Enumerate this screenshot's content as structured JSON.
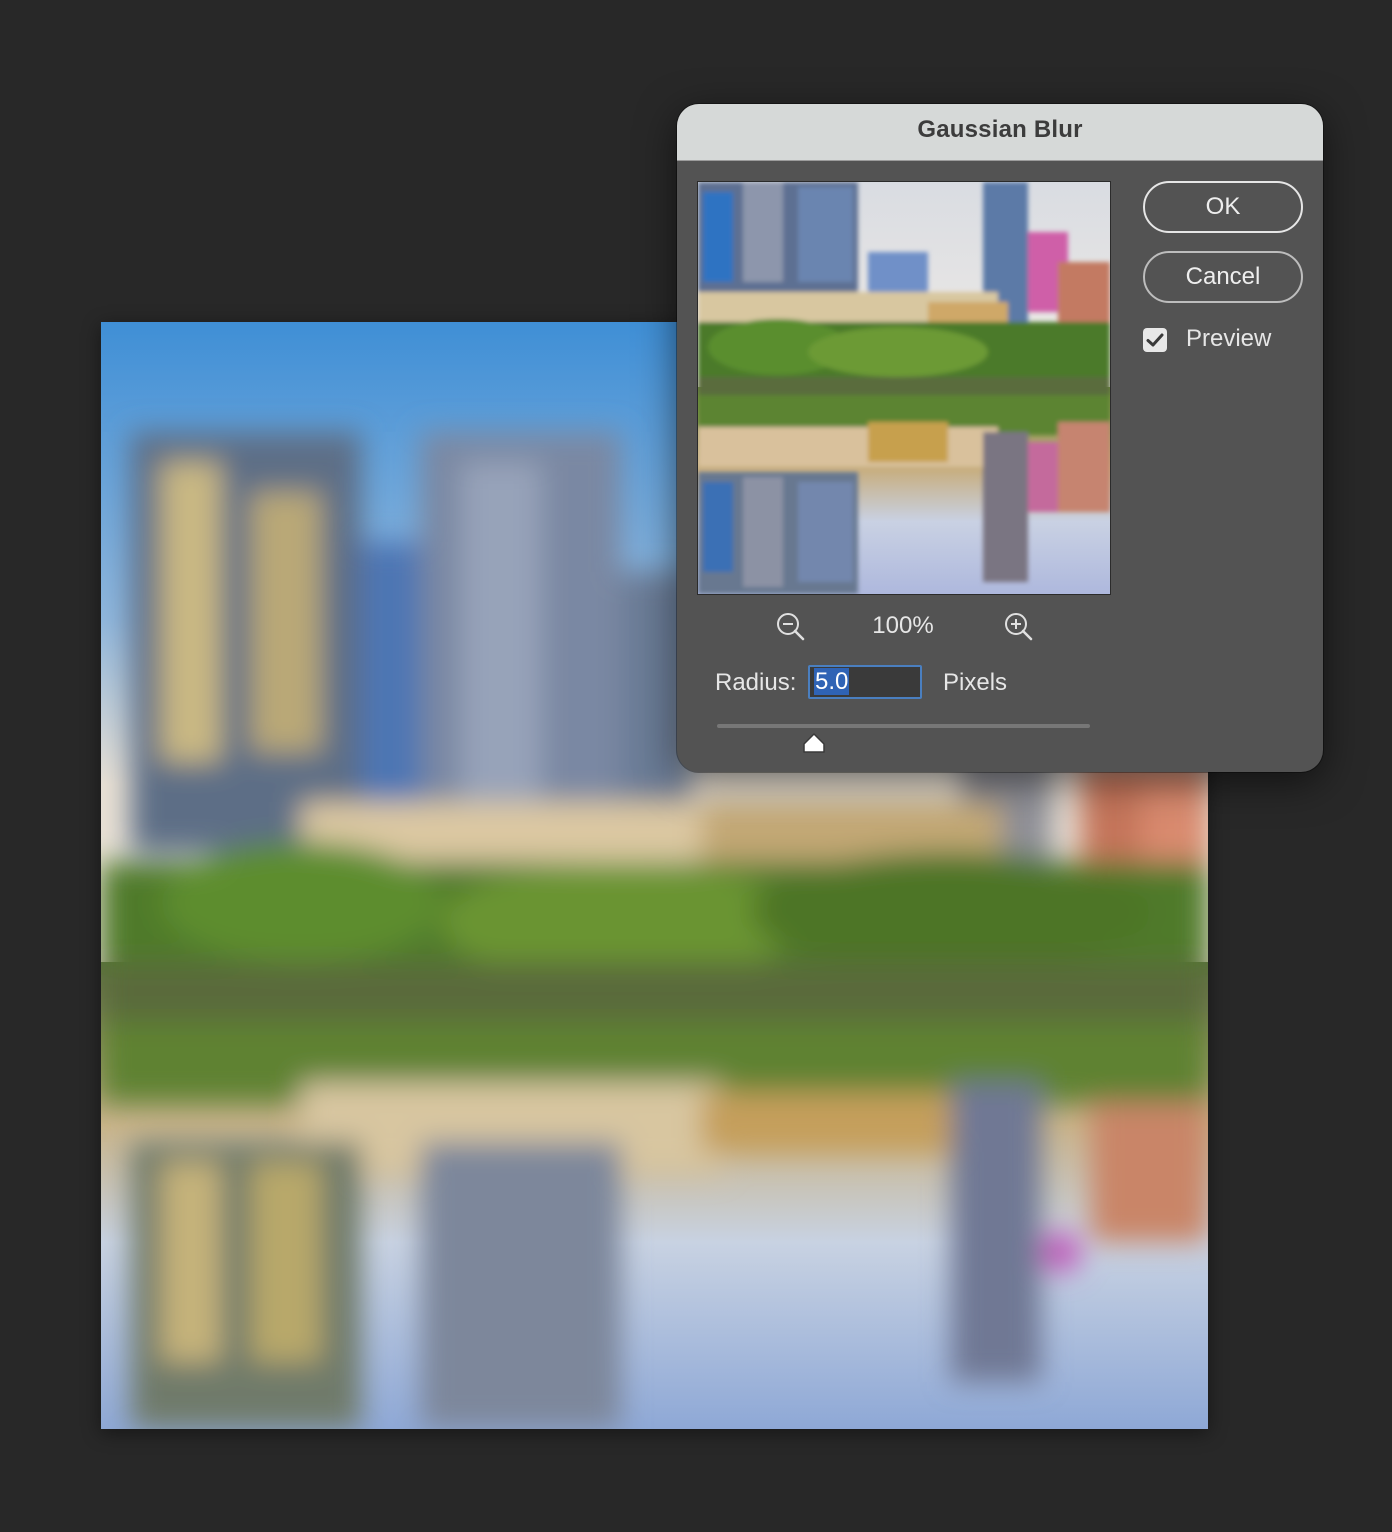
{
  "dialog": {
    "title": "Gaussian Blur",
    "ok_label": "OK",
    "cancel_label": "Cancel",
    "preview_label": "Preview",
    "preview_checked": true,
    "zoom_level": "100%",
    "zoom_out_icon": "zoom-out-icon",
    "zoom_in_icon": "zoom-in-icon",
    "radius_label": "Radius:",
    "radius_value": "5.0",
    "radius_unit": "Pixels",
    "slider_fraction": 0.26
  },
  "colors": {
    "dialog_bg": "#535353",
    "titlebar_bg": "#d6d9d8",
    "canvas_bg": "#282828",
    "input_focus": "#4a7fc0",
    "selection": "#2f63b5"
  }
}
